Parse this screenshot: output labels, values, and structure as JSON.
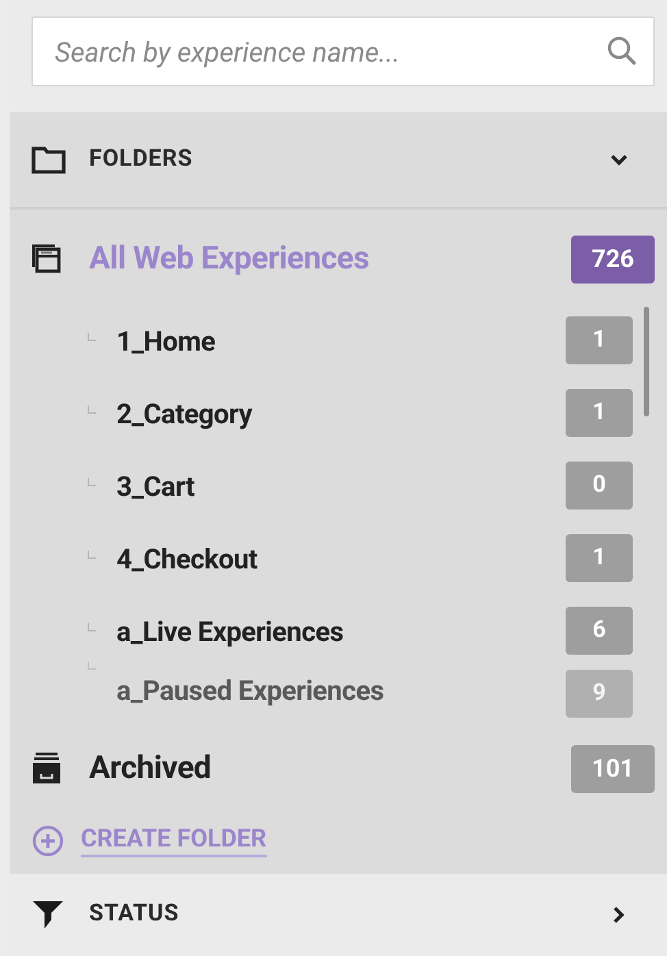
{
  "search": {
    "placeholder": "Search by experience name..."
  },
  "folders_section": {
    "title": "FOLDERS",
    "expanded": true
  },
  "root_items": [
    {
      "kind": "all",
      "label": "All Web Experiences",
      "count": "726",
      "selected": true,
      "children": [
        {
          "label": "1_Home",
          "count": "1",
          "faded": false
        },
        {
          "label": "2_Category",
          "count": "1",
          "faded": false
        },
        {
          "label": "3_Cart",
          "count": "0",
          "faded": false
        },
        {
          "label": "4_Checkout",
          "count": "1",
          "faded": false
        },
        {
          "label": "a_Live Experiences",
          "count": "6",
          "faded": false
        },
        {
          "label": "a_Paused Experiences",
          "count": "9",
          "faded": true
        }
      ]
    },
    {
      "kind": "archive",
      "label": "Archived",
      "count": "101",
      "selected": false
    }
  ],
  "create_folder": {
    "label": "CREATE FOLDER"
  },
  "status_section": {
    "title": "STATUS",
    "expanded": false
  }
}
